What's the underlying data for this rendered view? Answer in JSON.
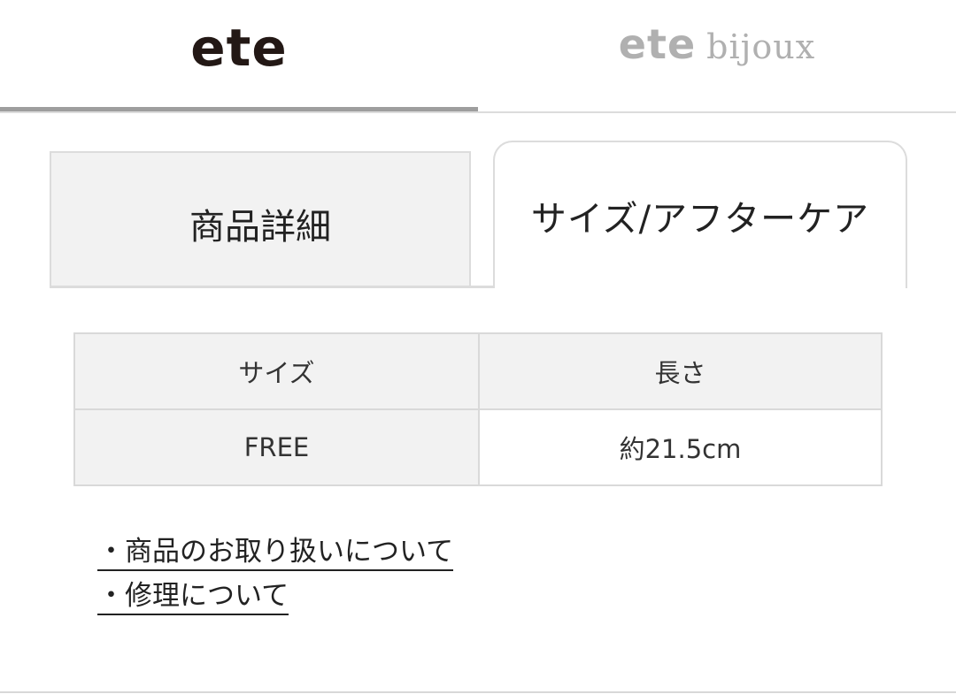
{
  "brand_tabs": {
    "ete_logo": "ete",
    "bijoux_logo_ete": "ete",
    "bijoux_logo_word": "bijoux",
    "active": "ete"
  },
  "content_tabs": [
    {
      "label": "商品詳細",
      "active": false
    },
    {
      "label": "サイズ/アフターケア",
      "active": true
    }
  ],
  "size_table": {
    "headers": [
      "サイズ",
      "長さ"
    ],
    "rows": [
      [
        "FREE",
        "約21.5cm"
      ]
    ]
  },
  "links": [
    "・商品のお取り扱いについて",
    "・修理について"
  ],
  "colors": {
    "active_underline": "#9e9e9e",
    "logo_active": "#231815",
    "logo_inactive": "#b0b0b0",
    "tab_inactive_bg": "#f2f2f2",
    "border": "#dcdcdc"
  }
}
